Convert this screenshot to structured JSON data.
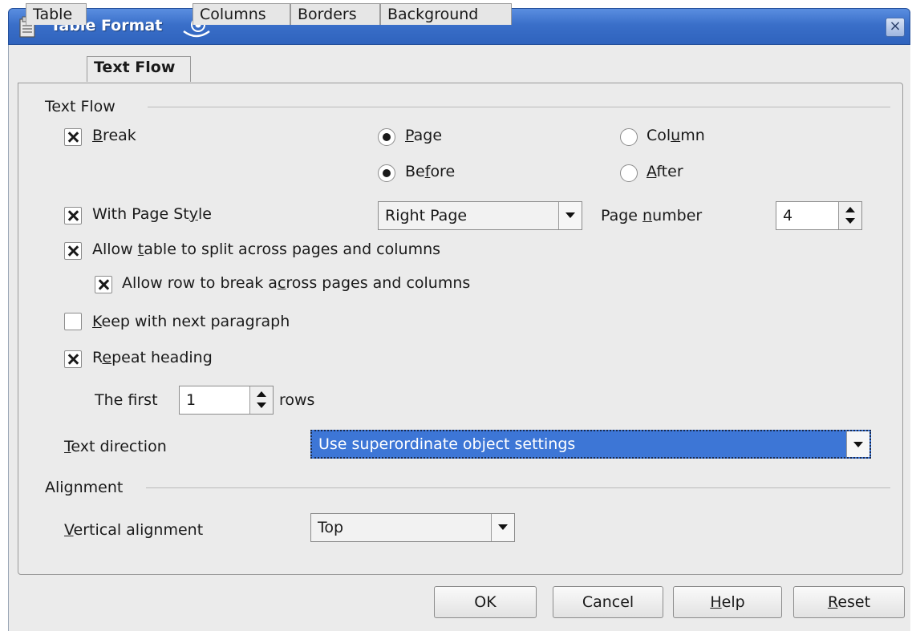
{
  "window": {
    "title": "Table Format",
    "close_label": "×"
  },
  "tabs": [
    {
      "label": "Table",
      "active": false
    },
    {
      "label": "Text Flow",
      "active": true
    },
    {
      "label": "Columns",
      "active": false
    },
    {
      "label": "Borders",
      "active": false
    },
    {
      "label": "Background",
      "active": false
    }
  ],
  "text_flow": {
    "group_label": "Text Flow",
    "break": {
      "label_u": "B",
      "label_rest": "reak",
      "checked": true
    },
    "page": {
      "label_u": "P",
      "label_rest": "age",
      "selected": true
    },
    "column": {
      "label_pre": "Col",
      "label_u": "u",
      "label_rest": "mn",
      "selected": false
    },
    "before": {
      "label_pre": "Be",
      "label_u": "f",
      "label_rest": "ore",
      "selected": true
    },
    "after": {
      "label_u": "A",
      "label_rest": "fter",
      "selected": false
    },
    "with_page_style": {
      "label_pre": "With Page St",
      "label_u": "y",
      "label_rest": "le",
      "checked": true
    },
    "page_style_value": "Right Page",
    "page_number": {
      "label_pre": "Page ",
      "label_u": "n",
      "label_rest": "umber",
      "value": "4"
    },
    "allow_split": {
      "label_pre": "Allow ",
      "label_u": "t",
      "label_rest": "able to split across pages and columns",
      "checked": true
    },
    "allow_row_break": {
      "label_pre": "Allow row to break a",
      "label_u": "c",
      "label_rest": "ross pages and columns",
      "checked": true
    },
    "keep_next": {
      "label_u": "K",
      "label_rest": "eep with next paragraph",
      "checked": false
    },
    "repeat_heading": {
      "label_pre": "R",
      "label_u": "e",
      "label_rest": "peat heading",
      "checked": true
    },
    "first_rows": {
      "label_pre": "The f",
      "label_u": "i",
      "label_rest": "rst",
      "value": "1",
      "suffix": "rows"
    },
    "text_direction": {
      "label_u": "T",
      "label_rest": "ext direction",
      "value": "Use superordinate object settings"
    }
  },
  "alignment": {
    "group_label": "Alignment",
    "vertical": {
      "label_u": "V",
      "label_rest": "ertical alignment",
      "value": "Top"
    }
  },
  "buttons": {
    "ok": "OK",
    "cancel": "Cancel",
    "help_u": "H",
    "help_rest": "elp",
    "reset_u": "R",
    "reset_rest": "eset"
  },
  "colors": {
    "titlebar": "#3a6fc9",
    "selection": "#3d76d6",
    "dialog_bg": "#ebebeb"
  }
}
